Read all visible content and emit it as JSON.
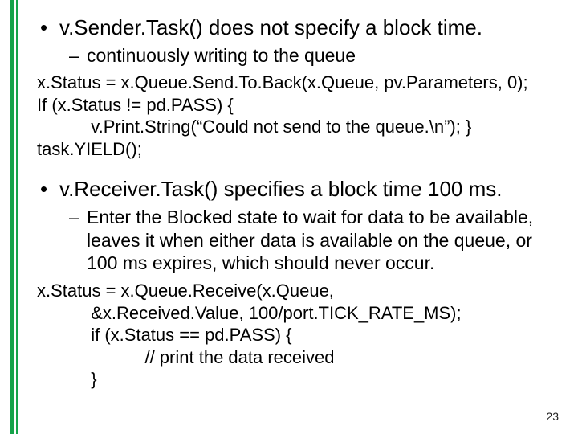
{
  "section1": {
    "bullet": "v.Sender.Task() does not specify a block time.",
    "subbullet": "continuously writing to the queue",
    "code": "x.Status = x.Queue.Send.To.Back(x.Queue, pv.Parameters, 0);\nIf (x.Status != pd.PASS) {\n           v.Print.String(“Could not send to the queue.\\n”); }\ntask.YIELD();"
  },
  "section2": {
    "bullet": "v.Receiver.Task() specifies a block time 100 ms.",
    "subbullet": "Enter the Blocked state to wait for data to be available, leaves it when either data is available on the queue, or 100 ms expires, which should never occur.",
    "code": "x.Status = x.Queue.Receive(x.Queue,\n           &x.Received.Value, 100/port.TICK_RATE_MS);\n           if (x.Status == pd.PASS) {\n                      // print the data received\n           }"
  },
  "page_number": "23"
}
